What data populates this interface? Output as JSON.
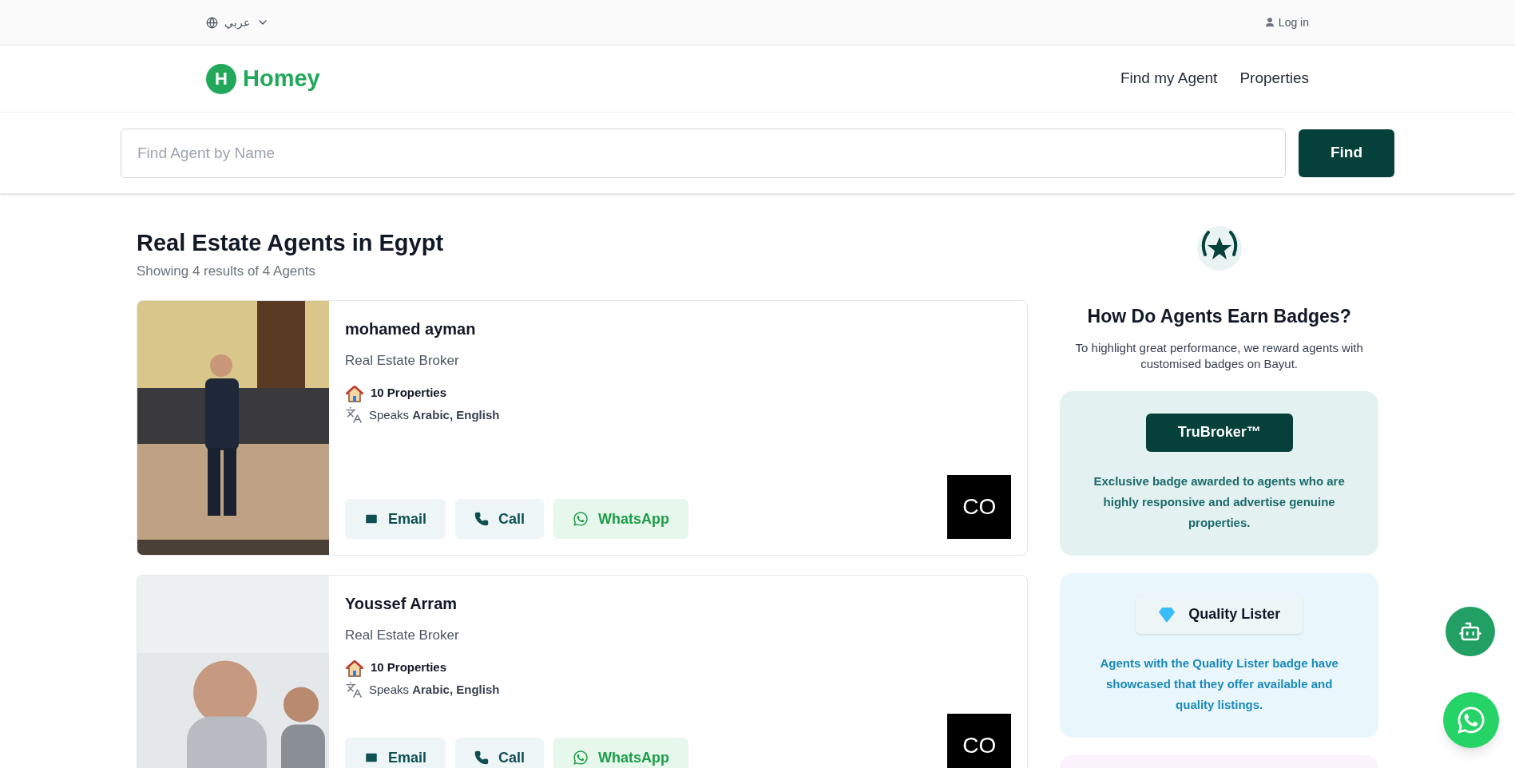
{
  "top_bar": {
    "language": "عربي",
    "login": "Log in"
  },
  "header": {
    "logo_letter": "H",
    "brand": "Homey",
    "nav": [
      "Find my Agent",
      "Properties"
    ]
  },
  "search": {
    "placeholder": "Find Agent by Name",
    "button": "Find"
  },
  "results": {
    "title": "Real Estate Agents in Egypt",
    "subtitle": "Showing 4 results of 4 Agents"
  },
  "agents": [
    {
      "name": "mohamed ayman",
      "role": "Real Estate Broker",
      "properties": "10 Properties",
      "languages": "Speaks **Arabic, English**",
      "logo": "CO",
      "actions": [
        {
          "kind": "email",
          "label": "Email"
        },
        {
          "kind": "call",
          "label": "Call"
        },
        {
          "kind": "whatsapp",
          "label": "WhatsApp"
        }
      ]
    },
    {
      "name": "Youssef Arram",
      "role": "Real Estate Broker",
      "properties": "10 Properties",
      "languages": "Speaks **Arabic, English**",
      "logo": "CO",
      "actions": [
        {
          "kind": "email",
          "label": "Email"
        },
        {
          "kind": "call",
          "label": "Call"
        },
        {
          "kind": "whatsapp",
          "label": "WhatsApp"
        }
      ]
    }
  ],
  "badges_panel": {
    "title": "How Do Agents Earn Badges?",
    "description": "To highlight great performance, we reward agents with customised badges on Bayut.",
    "badges": [
      {
        "kind": "trubroker",
        "label": "TruBroker™",
        "description": "Exclusive badge awarded to agents who are highly responsive and advertise genuine properties."
      },
      {
        "kind": "quality",
        "label": "Quality Lister",
        "description": "Agents with the Quality Lister badge have showcased that they offer available and quality listings."
      }
    ]
  }
}
